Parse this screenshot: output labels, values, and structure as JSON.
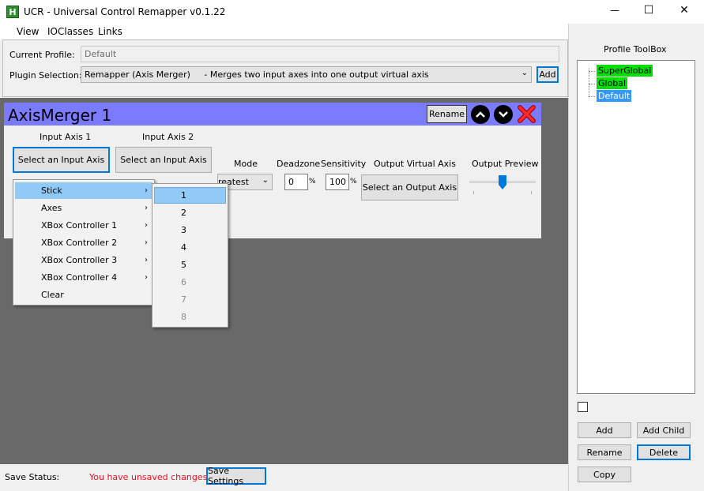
{
  "window": {
    "title": "UCR - Universal Control Remapper v0.1.22",
    "app_icon": "H",
    "controls": {
      "minimize": "—",
      "maximize": "☐",
      "close": "✕"
    }
  },
  "menubar": [
    "View",
    "IOClasses",
    "Links"
  ],
  "profile": {
    "label": "Current Profile:",
    "value": "Default"
  },
  "plugin": {
    "label": "Plugin Selection:",
    "selected": "Remapper (Axis Merger)     - Merges two input axes into one output virtual axis",
    "add_label": "Add"
  },
  "plugin_panel": {
    "title": "AxisMerger 1",
    "title_bar_color": "#7b7bff",
    "rename_label": "Rename",
    "input1": {
      "header": "Input Axis 1",
      "button": "Select an Input Axis"
    },
    "input2": {
      "header": "Input Axis 2",
      "button": "Select an Input Axis"
    },
    "mode": {
      "header": "Mode",
      "value": "reatest"
    },
    "deadzone": {
      "header": "Deadzone",
      "value": "0",
      "unit": "%"
    },
    "sensitivity": {
      "header": "Sensitivity",
      "value": "100",
      "unit": "%"
    },
    "output": {
      "header": "Output Virtual Axis",
      "button": "Select an Output Axis"
    },
    "preview": {
      "header": "Output Preview",
      "level": 0.5
    }
  },
  "input_menu": {
    "items": [
      "Stick",
      "Axes",
      "XBox Controller 1",
      "XBox Controller 2",
      "XBox Controller 3",
      "XBox Controller 4",
      "Clear"
    ],
    "submenu_arrow": "›"
  },
  "stick_submenu": {
    "items": [
      "1",
      "2",
      "3",
      "4",
      "5",
      "6",
      "7",
      "8"
    ]
  },
  "status": {
    "label": "Save Status:",
    "message": "You have unsaved changes",
    "message_color": "#e81123",
    "save_label": "Save Settings"
  },
  "toolbox": {
    "title": "Profile ToolBox",
    "tree": [
      {
        "label": "SuperGlobal",
        "color": "#00e000"
      },
      {
        "label": "Global",
        "color": "#00e000"
      },
      {
        "label": "Default",
        "color": "#3399ff"
      }
    ],
    "buttons": {
      "add": "Add",
      "add_child": "Add Child",
      "rename": "Rename",
      "delete": "Delete",
      "copy": "Copy"
    }
  }
}
